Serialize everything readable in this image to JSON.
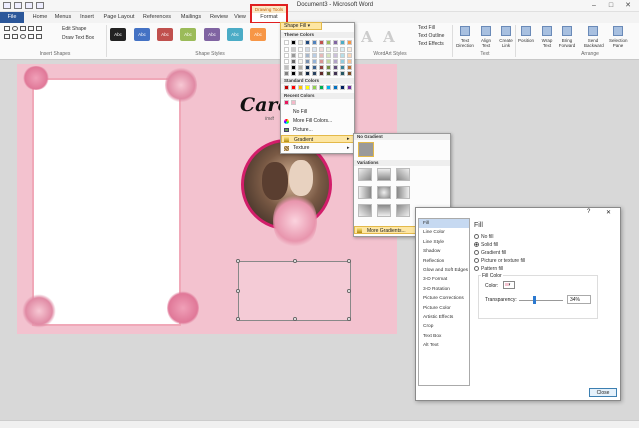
{
  "window": {
    "title": "Document3 - Microsoft Word",
    "controls": [
      "–",
      "□",
      "✕"
    ]
  },
  "contextual": {
    "group_label": "Drawing Tools",
    "tab": "Format"
  },
  "tabs": [
    "File",
    "Home",
    "Menus",
    "Insert",
    "Page Layout",
    "References",
    "Mailings",
    "Review",
    "View"
  ],
  "ribbon": {
    "edit_shape": "Edit Shape",
    "draw_text_box": "Draw Text Box",
    "groups": [
      "Insert Shapes",
      "Shape Styles",
      "WordArt Styles",
      "Text",
      "Arrange"
    ],
    "shape_fill": "Shape Fill",
    "style_label": "Abc",
    "style_colors": [
      "#222222",
      "#4472c4",
      "#c0504d",
      "#9bbb59",
      "#8064a2",
      "#4bacc6",
      "#f79646"
    ],
    "text_fill": "Text Fill",
    "text_outline": "Text Outline",
    "text_effects": "Text Effects",
    "text_buttons": [
      "Text Direction",
      "Align Text",
      "Create Link"
    ],
    "arrange_buttons": [
      "Position",
      "Wrap Text",
      "Bring Forward",
      "Send Backward",
      "Selection Pane"
    ],
    "wordart_letter": "A"
  },
  "document": {
    "title_text": "Caro",
    "subtitle_text": "invit"
  },
  "fill_menu": {
    "theme_colors_label": "Theme Colors",
    "standard_colors_label": "Standard Colors",
    "recent_colors_label": "Recent Colors",
    "no_fill": "No Fill",
    "more_fill_colors": "More Fill Colors...",
    "picture": "Picture...",
    "gradient": "Gradient",
    "texture": "Texture",
    "theme_columns": [
      "#ffffff",
      "#000000",
      "#eeece1",
      "#1f497d",
      "#4f81bd",
      "#c0504d",
      "#9bbb59",
      "#8064a2",
      "#4bacc6",
      "#f79646"
    ],
    "standard": [
      "#c00000",
      "#ff0000",
      "#ffc000",
      "#ffff00",
      "#92d050",
      "#00b050",
      "#00b0f0",
      "#0070c0",
      "#002060",
      "#7030a0"
    ],
    "recent": [
      "#e8185f",
      "#f4b8c8"
    ]
  },
  "gradient_menu": {
    "no_gradient": "No Gradient",
    "variations": "Variations",
    "more_gradients": "More Gradients..."
  },
  "dialog": {
    "help": "?",
    "close_x": "✕",
    "nav": [
      "Fill",
      "Line Color",
      "Line Style",
      "Shadow",
      "Reflection",
      "Glow and Soft Edges",
      "3-D Format",
      "3-D Rotation",
      "Picture Corrections",
      "Picture Color",
      "Artistic Effects",
      "Crop",
      "Text Box",
      "Alt Text"
    ],
    "section": "Fill",
    "options": [
      "No fill",
      "Solid fill",
      "Gradient fill",
      "Picture or texture fill",
      "Pattern fill"
    ],
    "selected_option": "Solid fill",
    "fill_color_label": "Fill Color",
    "color_label": "Color:",
    "transparency_label": "Transparency:",
    "transparency_value": "34%",
    "transparency_fraction": 0.34,
    "close": "Close"
  }
}
